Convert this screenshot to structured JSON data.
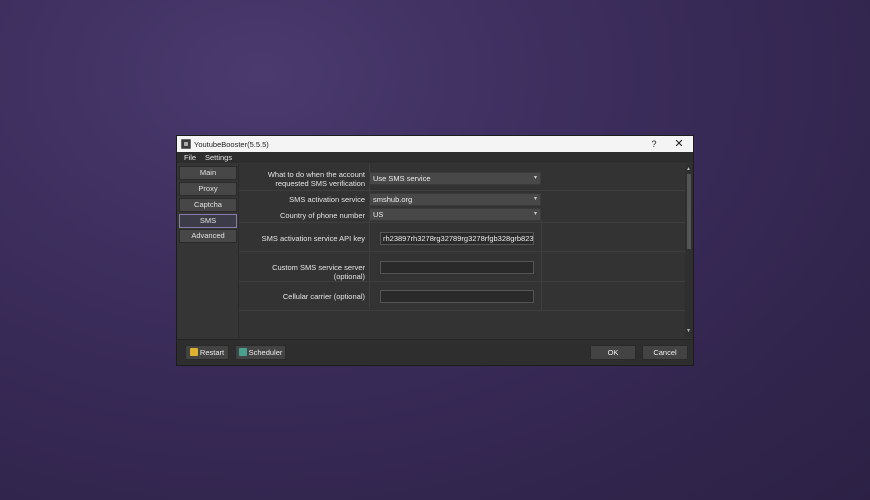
{
  "window": {
    "title": "YoutubeBooster(5.5.5)",
    "help": "?",
    "close": "✕"
  },
  "menu": {
    "file": "File",
    "settings": "Settings"
  },
  "nav": {
    "items": [
      "Main",
      "Proxy",
      "Captcha",
      "SMS",
      "Advanced"
    ],
    "active": "SMS"
  },
  "form": {
    "when_verify": {
      "label_line1": "What to do when the account",
      "label_line2": "requested SMS verification",
      "value": "Use SMS service"
    },
    "sms_service": {
      "label": "SMS activation service",
      "value": "smshub.org"
    },
    "country": {
      "label": "Country of phone number",
      "value": "US"
    },
    "api_key": {
      "label": "SMS activation service API key",
      "value": "rh23897rh3278rg32789rg3278rfgb328grb823"
    },
    "custom_server": {
      "label": "Custom SMS service server (optional)",
      "value": ""
    },
    "carrier": {
      "label": "Cellular carrier (optional)",
      "value": ""
    }
  },
  "buttons": {
    "restart": "Restart",
    "scheduler": "Scheduler",
    "ok": "OK",
    "cancel": "Cancel"
  },
  "icons": {
    "arrow": "▾",
    "scroll_up": "▲",
    "scroll_down": "▼"
  },
  "colors": {
    "desktop": "#3d2e5e",
    "window_bg": "#353535",
    "active_nav_border": "#8a7aa8"
  }
}
